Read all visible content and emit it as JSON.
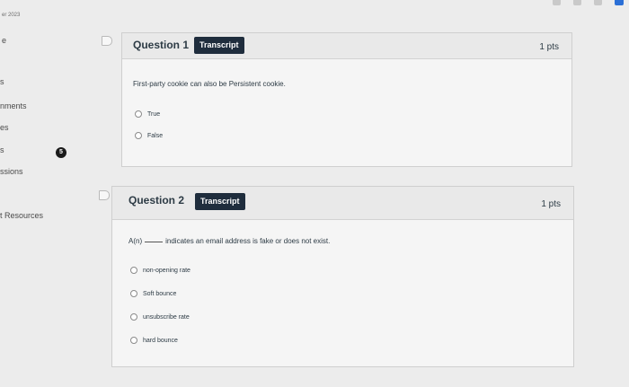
{
  "header": {
    "semester_text": "er 2023"
  },
  "nav": {
    "items": [
      {
        "label": "e"
      },
      {
        "label": "s"
      },
      {
        "label": "nments"
      },
      {
        "label": "es"
      },
      {
        "label": "s"
      },
      {
        "label": "ssions"
      },
      {
        "label": "t Resources"
      }
    ],
    "badge_count": "5"
  },
  "questions": [
    {
      "title": "Question 1",
      "transcript_label": "Transcript",
      "points": "1 pts",
      "text": "First-party cookie can also be Persistent cookie.",
      "options": [
        "True",
        "False"
      ]
    },
    {
      "title": "Question 2",
      "transcript_label": "Transcript",
      "points": "1 pts",
      "text_before": "A(n)",
      "text_after": "indicates an email address is fake or does not exist.",
      "options": [
        "non-opening rate",
        "Soft bounce",
        "unsubscribe rate",
        "hard bounce"
      ]
    }
  ],
  "colors": {
    "transcript_button_bg": "#1f2d3d",
    "accent_blue": "#2b6fd6"
  }
}
